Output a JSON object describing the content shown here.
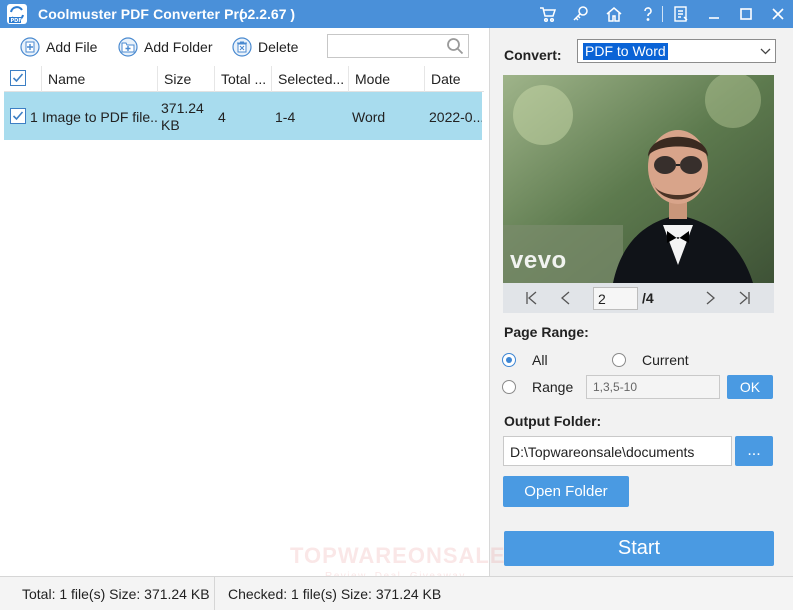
{
  "window": {
    "title": "Coolmuster PDF Converter Pro",
    "version": "( 2.2.67 )"
  },
  "toolbar": {
    "add_file": "Add File",
    "add_folder": "Add Folder",
    "delete": "Delete",
    "search_value": ""
  },
  "table": {
    "columns": [
      "Name",
      "Size",
      "Total ...",
      "Selected...",
      "Mode",
      "Date"
    ],
    "rows": [
      {
        "index": "1",
        "name": "Image to PDF file...",
        "size_line1": "371.24",
        "size_line2": "KB",
        "total": "4",
        "selected": "1-4",
        "mode": "Word",
        "date": "2022-0..."
      }
    ]
  },
  "convert": {
    "label": "Convert:",
    "selected": "PDF to Word"
  },
  "preview": {
    "watermark": "vevo"
  },
  "pager": {
    "current_page": "2",
    "total_pages": "/4"
  },
  "page_range": {
    "label": "Page Range:",
    "all": "All",
    "current": "Current",
    "range": "Range",
    "range_placeholder": "1,3,5-10",
    "ok": "OK",
    "selected": "All"
  },
  "output": {
    "label": "Output Folder:",
    "path": "D:\\Topwareonsale\\documents",
    "browse": "...",
    "open_folder": "Open Folder"
  },
  "start": "Start",
  "watermark": {
    "main": "TOPWAREONSALE",
    "sub": "Review, Deal, Giveaway"
  },
  "status": {
    "total": "Total: 1 file(s) Size: 371.24 KB",
    "checked": "Checked: 1 file(s) Size: 371.24 KB"
  },
  "colors": {
    "titlebar": "#4a90d9",
    "selected_row": "#a8dcee",
    "button_blue": "#4a9ae2"
  }
}
